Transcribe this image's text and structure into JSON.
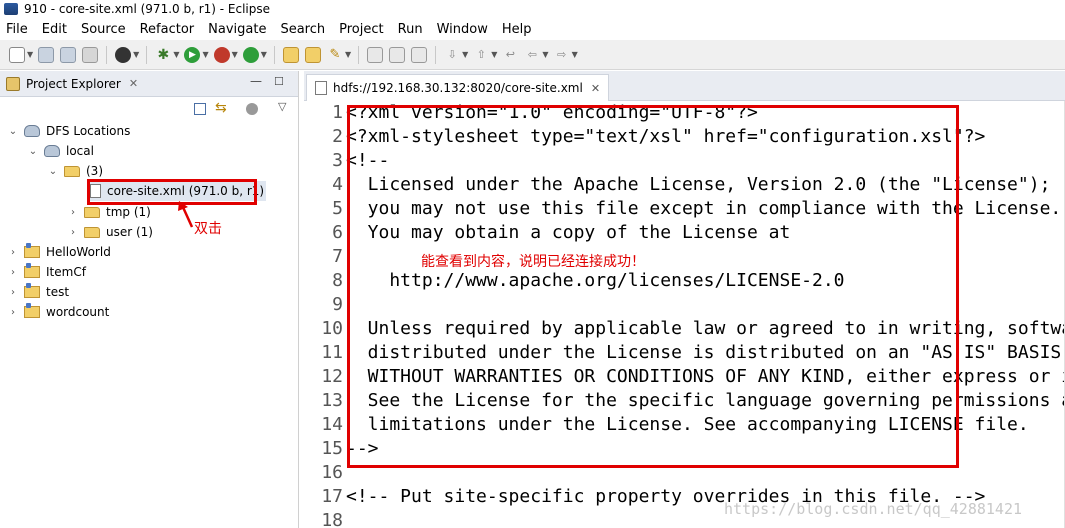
{
  "window": {
    "title": "910 - core-site.xml (971.0 b, r1) - Eclipse"
  },
  "menu": [
    "File",
    "Edit",
    "Source",
    "Refactor",
    "Navigate",
    "Search",
    "Project",
    "Run",
    "Window",
    "Help"
  ],
  "toolbar": {
    "icons": [
      "new-icon",
      "save-icon",
      "save-all-icon",
      "print-icon",
      "profile-icon",
      "debug-icon",
      "run-icon",
      "coverage-icon",
      "external-tools-icon",
      "new-java-project-icon",
      "open-type-icon",
      "search-icon",
      "next-annotation-icon",
      "prev-annotation-icon",
      "back-icon",
      "forward-icon"
    ]
  },
  "explorer": {
    "tab_label": "Project Explorer",
    "tree": {
      "root": "DFS Locations",
      "location": "local",
      "folder_root": "(3)",
      "selected_file": "core-site.xml (971.0 b, r1)",
      "subfolders": [
        "tmp (1)",
        "user (1)"
      ],
      "projects": [
        "HelloWorld",
        "ItemCf",
        "test",
        "wordcount"
      ]
    }
  },
  "editor": {
    "tab_label": "hdfs://192.168.30.132:8020/core-site.xml",
    "lines": [
      {
        "n": "1",
        "text": "<?xml version=\"1.0\" encoding=\"UTF-8\"?>"
      },
      {
        "n": "2",
        "text": "<?xml-stylesheet type=\"text/xsl\" href=\"configuration.xsl\"?>"
      },
      {
        "n": "3",
        "text": "<!--"
      },
      {
        "n": "4",
        "text": "  Licensed under the Apache License, Version 2.0 (the \"License\");"
      },
      {
        "n": "5",
        "text": "  you may not use this file except in compliance with the License."
      },
      {
        "n": "6",
        "text": "  You may obtain a copy of the License at"
      },
      {
        "n": "7",
        "text": ""
      },
      {
        "n": "8",
        "text": "    http://www.apache.org/licenses/LICENSE-2.0"
      },
      {
        "n": "9",
        "text": ""
      },
      {
        "n": "10",
        "text": "  Unless required by applicable law or agreed to in writing, software"
      },
      {
        "n": "11",
        "text": "  distributed under the License is distributed on an \"AS IS\" BASIS,"
      },
      {
        "n": "12",
        "text": "  WITHOUT WARRANTIES OR CONDITIONS OF ANY KIND, either express or implied."
      },
      {
        "n": "13",
        "text": "  See the License for the specific language governing permissions and"
      },
      {
        "n": "14",
        "text": "  limitations under the License. See accompanying LICENSE file."
      },
      {
        "n": "15",
        "text": "-->"
      },
      {
        "n": "16",
        "text": ""
      },
      {
        "n": "17",
        "text": "<!-- Put site-specific property overrides in this file. -->"
      },
      {
        "n": "18",
        "text": ""
      }
    ]
  },
  "annotations": {
    "double_click": "双击",
    "success_note": "能查看到内容，说明已经连接成功！",
    "color": "#e00000"
  },
  "watermark": "https://blog.csdn.net/qq_42881421"
}
